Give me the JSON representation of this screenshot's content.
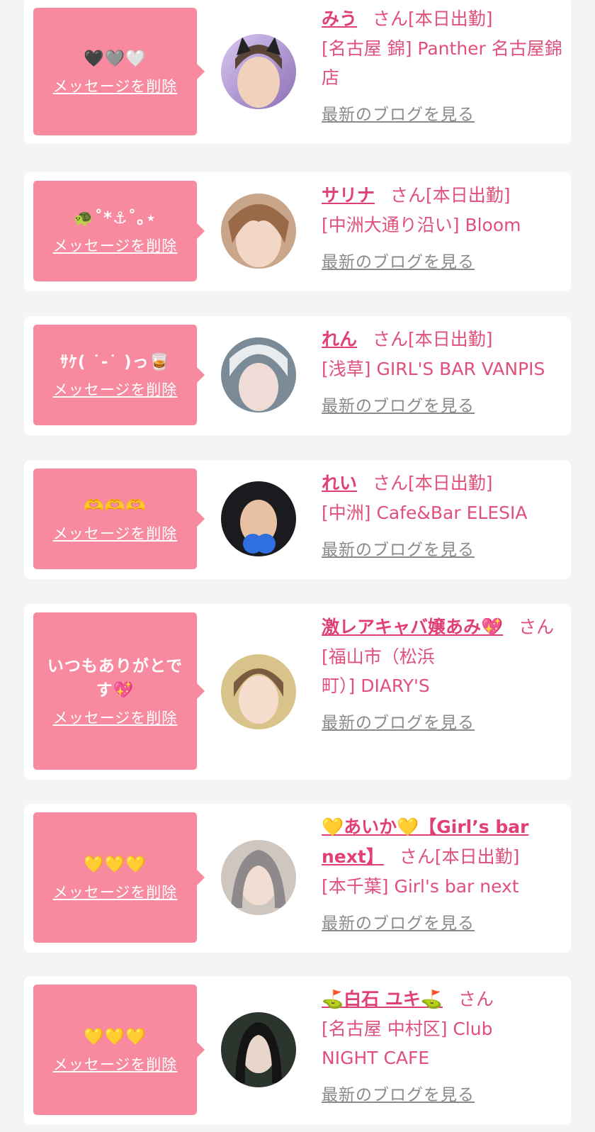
{
  "common": {
    "delete_label": "メッセージを削除",
    "san_label": "さん",
    "blog_label": "最新のブログを見る"
  },
  "entries": [
    {
      "message": "🖤🩶🤍",
      "name": "みう",
      "status": "[本日出勤]",
      "shop": "[名古屋 錦] Panther 名古屋錦店"
    },
    {
      "message": "🐢˚*⚓︎˚｡⋆",
      "name": "サリナ",
      "status": "[本日出勤]",
      "shop": "[中洲大通り沿い] Bloom"
    },
    {
      "message": "ｻｹ( ˙-˙ )っ🥃",
      "name": "れん",
      "status": "[本日出勤]",
      "shop": "[浅草] GIRL'S BAR VANPIS"
    },
    {
      "message": "🫶🫶🫶",
      "name": "れい",
      "status": "[本日出勤]",
      "shop": "[中洲] Cafe&Bar ELESIA"
    },
    {
      "message": "いつもありがとです💖",
      "name": "激レアキャバ嬢あみ💖",
      "status": "",
      "shop": "[福山市（松浜町）] DIARY'S"
    },
    {
      "message": "💛💛💛",
      "name": "💛あいか💛【Girl’s bar next】",
      "status": "[本日出勤]",
      "shop": "[本千葉] Girl's bar next"
    },
    {
      "message": "💛💛💛",
      "name": "⛳️白石 ユキ⛳️",
      "status": "",
      "shop": "[名古屋 中村区] Club NIGHT CAFE"
    }
  ],
  "colors": {
    "bubble": "#f88aa0",
    "name": "#e04074",
    "text": "#e0507a",
    "blog": "#8a8a8a"
  }
}
